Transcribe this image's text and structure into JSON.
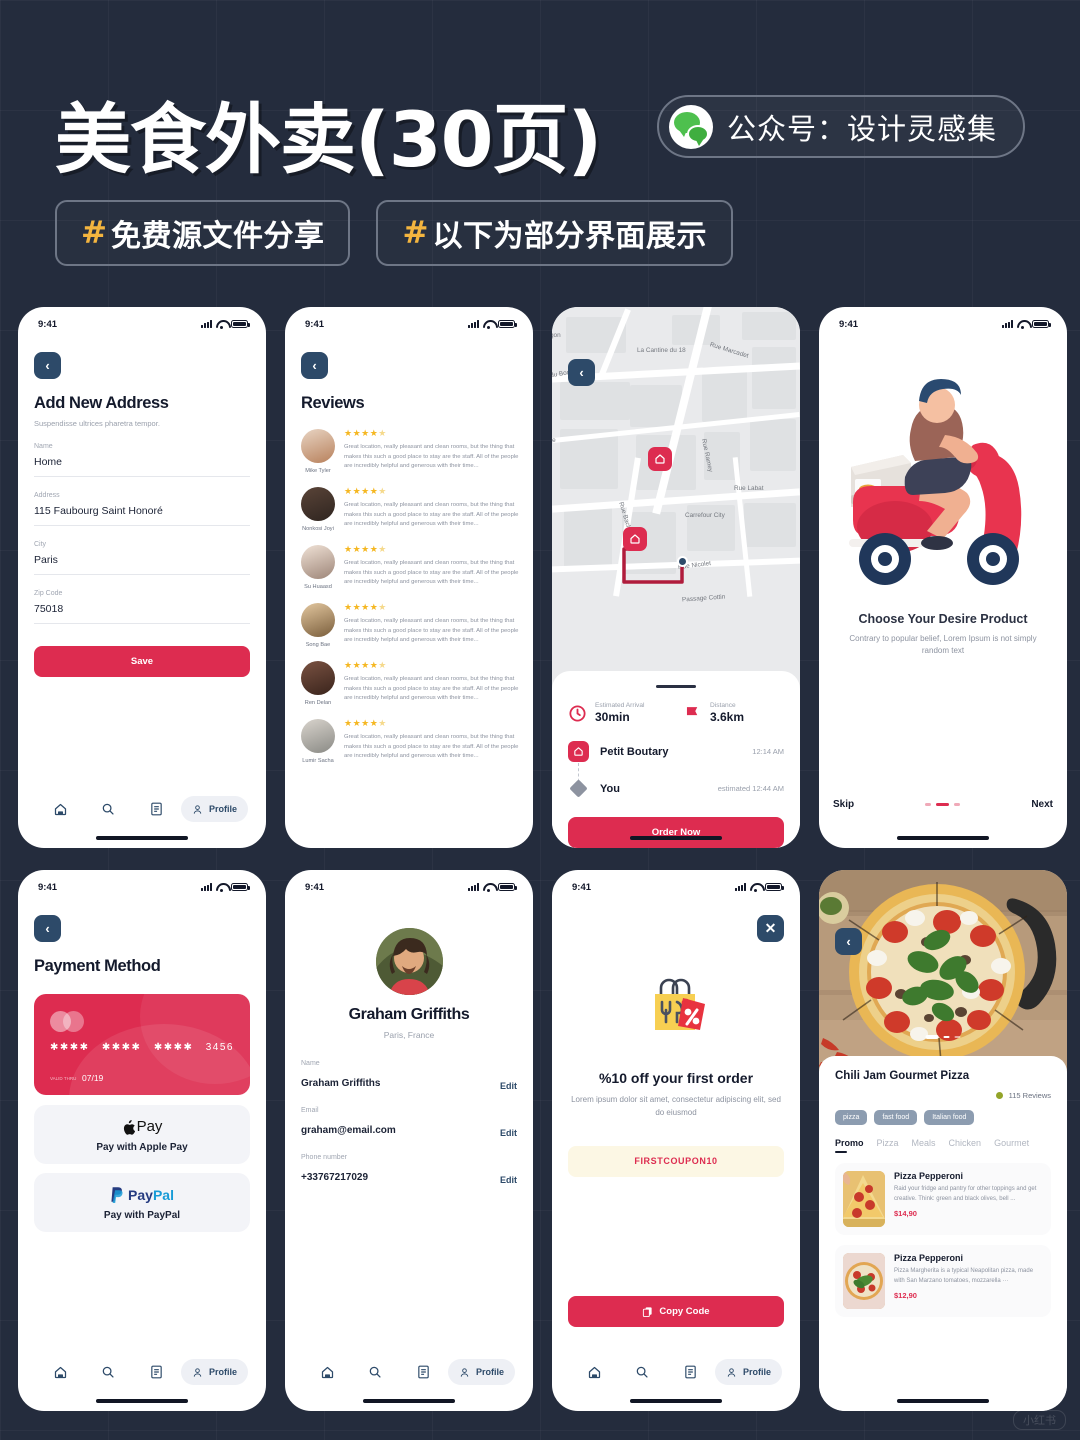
{
  "header": {
    "title": "美食外卖(30页)",
    "wechat": {
      "icon": "wechat-icon",
      "text": "公众号：设计灵感集"
    },
    "tags": [
      {
        "hash": "#",
        "label": "免费源文件分享"
      },
      {
        "hash": "#",
        "label": "以下为部分界面展示"
      }
    ]
  },
  "watermark": "小红书",
  "colors": {
    "background": "#242c3d",
    "accent_red": "#dd2c50",
    "accent_navy": "#2d4a69",
    "star_yellow": "#f5b721",
    "tag_yellow": "#f4b53f"
  },
  "status_bar": {
    "time": "9:41",
    "signal": "signal-bars-icon",
    "wifi": "wifi-icon",
    "battery": "battery-icon"
  },
  "tabbar": {
    "home": "home-icon",
    "search": "search-icon",
    "orders": "list-icon",
    "profile_label": "Profile"
  },
  "screens": {
    "add_address": {
      "back": "‹",
      "title": "Add New Address",
      "subtitle": "Suspendisse ultrices pharetra tempor.",
      "fields": [
        {
          "label": "Name",
          "value": "Home"
        },
        {
          "label": "Address",
          "value": "115 Faubourg Saint Honoré"
        },
        {
          "label": "City",
          "value": "Paris"
        },
        {
          "label": "Zip Code",
          "value": "75018"
        }
      ],
      "save_label": "Save"
    },
    "reviews": {
      "back": "‹",
      "title": "Reviews",
      "items": [
        {
          "name": "Mike Tyler",
          "stars": 4,
          "text": "Great location, really pleasant and clean rooms, but the thing that makes this such a good place to stay are the staff. All of the people are incredibly helpful and generous with their time..."
        },
        {
          "name": "Nonkosi Joyi",
          "stars": 4,
          "text": "Great location, really pleasant and clean rooms, but the thing that makes this such a good place to stay are the staff. All of the people are incredibly helpful and generous with their time..."
        },
        {
          "name": "Su Huaasd",
          "stars": 4,
          "text": "Great location, really pleasant and clean rooms, but the thing that makes this such a good place to stay are the staff. All of the people are incredibly helpful and generous with their time..."
        },
        {
          "name": "Song Bae",
          "stars": 4,
          "text": "Great location, really pleasant and clean rooms, but the thing that makes this such a good place to stay are the staff. All of the people are incredibly helpful and generous with their time..."
        },
        {
          "name": "Ren Delan",
          "stars": 4,
          "text": "Great location, really pleasant and clean rooms, but the thing that makes this such a good place to stay are the staff. All of the people are incredibly helpful and generous with their time..."
        },
        {
          "name": "Lumir Sacha",
          "stars": 4,
          "text": "Great location, really pleasant and clean rooms, but the thing that makes this such a good place to stay are the staff. All of the people are incredibly helpful and generous with their time..."
        }
      ]
    },
    "tracking": {
      "back": "‹",
      "map_labels": [
        "La Cantine du 18",
        "Rue Marcadet",
        "Rue Ramey",
        "Rue Labat",
        "Carrefour City",
        "Rue Bachelet",
        "Rue Nicolet",
        "Passage Cottin",
        "du Bon Coeur",
        "gon",
        "re"
      ],
      "eta_label": "Estimated Arrival",
      "eta_value": "30min",
      "distance_label": "Distance",
      "distance_value": "3.6km",
      "stops": [
        {
          "name": "Petit Boutary",
          "time": "12:14 AM",
          "icon": "home-pin-icon"
        },
        {
          "name": "You",
          "time": "estimated 12:44 AM",
          "icon": "diamond-pin-icon"
        }
      ],
      "order_label": "Order Now"
    },
    "onboarding": {
      "illustration": "delivery-scooter-illustration",
      "title": "Choose Your Desire Product",
      "subtitle": "Contrary to popular belief, Lorem Ipsum is not simply random text",
      "skip_label": "Skip",
      "next_label": "Next",
      "dots": 3,
      "active_dot": 2
    },
    "payment": {
      "back": "‹",
      "title": "Payment Method",
      "card": {
        "brand": "mastercard-icon",
        "groups": [
          "✱✱✱✱",
          "✱✱✱✱",
          "✱✱✱✱"
        ],
        "last4": "3456",
        "valid_label": "VALID THRU",
        "expiry": "07/19"
      },
      "methods": [
        {
          "logo": "apple-pay-logo",
          "label": "Pay with Apple Pay"
        },
        {
          "logo": "paypal-logo",
          "label": "Pay with PayPal"
        }
      ]
    },
    "profile": {
      "avatar": "user-avatar",
      "name": "Graham Griffiths",
      "location": "Paris, France",
      "rows": [
        {
          "key": "Name",
          "value": "Graham Griffiths",
          "action": "Edit"
        },
        {
          "key": "Email",
          "value": "graham@email.com",
          "action": "Edit"
        },
        {
          "key": "Phone number",
          "value": "+33767217029",
          "action": "Edit"
        }
      ]
    },
    "coupon": {
      "close": "✕",
      "illustration": "shopping-bag-discount-icon",
      "title": "%10 off your first order",
      "subtitle": "Lorem ipsum dolor sit amet, consectetur adipiscing elit, sed do eiusmod",
      "code": "FIRSTCOUPON10",
      "copy_label": "Copy Code",
      "copy_icon": "copy-icon"
    },
    "dish_detail": {
      "back": "‹",
      "hero": "pizza-hero-image",
      "title": "Chili Jam Gourmet Pizza",
      "reviews_count": "115 Reviews",
      "chips": [
        "pizza",
        "fast food",
        "Italian food"
      ],
      "categories": [
        "Promo",
        "Pizza",
        "Meals",
        "Chicken",
        "Gourmet"
      ],
      "active_category": "Promo",
      "menu": [
        {
          "name": "Pizza Pepperoni",
          "desc": "Raid your fridge and pantry for other toppings and get creative. Think: green and black olives, bell ...",
          "price": "$14,90"
        },
        {
          "name": "Pizza Pepperoni",
          "desc": "Pizza Margherita is a typical Neapolitan pizza, made with San Marzano tomatoes, mozzarella ···",
          "price": "$12,90"
        }
      ]
    }
  }
}
